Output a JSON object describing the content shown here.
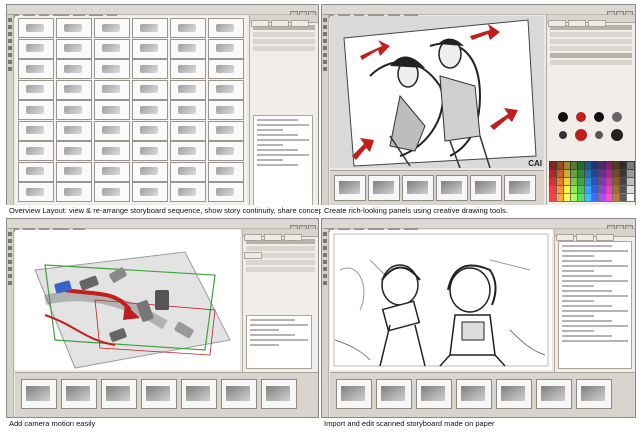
{
  "panels": [
    {
      "id": "overview",
      "caption": "Overview Layout: view & re-arrange storyboard sequence, show story continuity, share concepts"
    },
    {
      "id": "drawing",
      "caption": "Create rich-looking panels using creative drawing tools.",
      "watermark": "CAI"
    },
    {
      "id": "camera",
      "caption": "Add camera motion easily"
    },
    {
      "id": "scanned",
      "caption": "Import and edit scanned storyboard made on paper"
    }
  ],
  "icons": [
    "menu-bar",
    "toolbar-icon",
    "palette-swatch",
    "red-arrow",
    "camera-frame"
  ],
  "colors": {
    "window_bg": "#ece9e4",
    "panel_bg": "#f1eee9",
    "accent_red": "#c0201c",
    "swatch_palette": [
      "#d92f2f",
      "#e97a2f",
      "#f2d43a",
      "#7fc243",
      "#3aa54b",
      "#2d8bd6",
      "#2f4fb5",
      "#7a3bb0",
      "#c23a9a",
      "#8b5a2b",
      "#444444",
      "#bbbbbb"
    ]
  }
}
